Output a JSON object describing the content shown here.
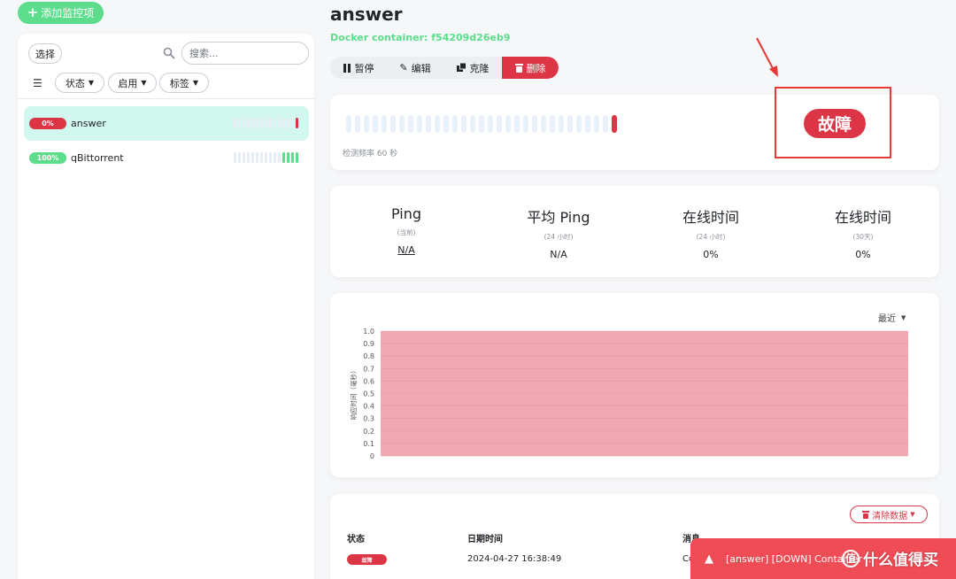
{
  "sidebar": {
    "add_label": "添加监控项",
    "select_label": "选择",
    "search_placeholder": "搜索...",
    "filters": {
      "status": "状态",
      "active": "启用",
      "tags": "标签"
    },
    "monitors": [
      {
        "percent": "0%",
        "name": "answer",
        "beats": [
          "empty",
          "empty",
          "empty",
          "empty",
          "empty",
          "empty",
          "empty",
          "empty",
          "empty",
          "empty",
          "empty",
          "empty",
          "empty",
          "empty",
          "down"
        ]
      },
      {
        "percent": "100%",
        "name": "qBittorrent",
        "beats": [
          "empty",
          "empty",
          "empty",
          "empty",
          "empty",
          "empty",
          "empty",
          "empty",
          "empty",
          "empty",
          "empty",
          "up",
          "up",
          "up",
          "up"
        ]
      }
    ]
  },
  "header": {
    "title": "answer",
    "subtitle": "Docker container: f54209d26eb9"
  },
  "toolbar": {
    "pause": "暂停",
    "edit": "编辑",
    "clone": "克隆",
    "delete": "删除"
  },
  "heartbeat": {
    "frequency": "检测频率 60 秒",
    "status": "故障",
    "beats_empty": 30,
    "beats_down": 1
  },
  "stats": [
    {
      "label": "Ping",
      "sub": "(当前)",
      "value": "N/A"
    },
    {
      "label": "平均 Ping",
      "sub": "(24 小时)",
      "value": "N/A"
    },
    {
      "label": "在线时间",
      "sub": "(24 小时)",
      "value": "0%"
    },
    {
      "label": "在线时间",
      "sub": "(30天)",
      "value": "0%"
    }
  ],
  "chart": {
    "period": "最近"
  },
  "chart_data": {
    "type": "area",
    "ylabel": "响应时间（毫秒）",
    "ylim": [
      0,
      1.0
    ],
    "yticks": [
      "0",
      "0.1",
      "0.2",
      "0.3",
      "0.4",
      "0.5",
      "0.6",
      "0.7",
      "0.8",
      "0.9",
      "1.0"
    ],
    "series": [
      {
        "values": [
          1.0,
          1.0
        ],
        "status": "down"
      }
    ],
    "colors": {
      "down": "#f0a9b0"
    },
    "grid": true
  },
  "events": {
    "clear_label": "清除数据",
    "headers": {
      "status": "状态",
      "datetime": "日期时间",
      "message": "消息"
    },
    "rows": [
      {
        "status": "故障",
        "datetime": "2024-04-27 16:38:49",
        "message": "Co"
      }
    ]
  },
  "toast": {
    "text": "[answer] [DOWN] Container ... "
  },
  "watermark": {
    "text": "什么值得买",
    "logo": "值"
  }
}
